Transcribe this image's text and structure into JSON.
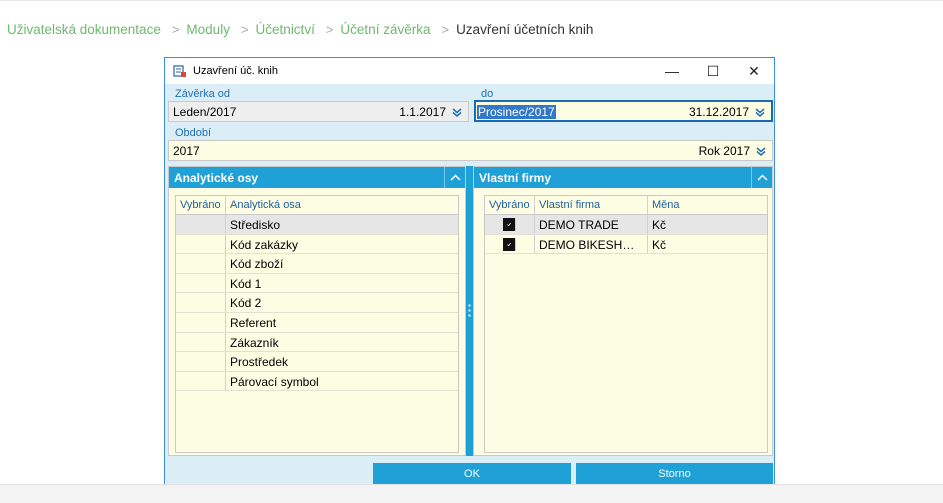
{
  "breadcrumb": {
    "items": [
      "Uživatelská dokumentace",
      "Moduly",
      "Účetnictví",
      "Účetní závěrka"
    ],
    "separator": ">",
    "current": "Uzavření účetních knih"
  },
  "dialog": {
    "title": "Uzavření úč. knih",
    "window_controls": {
      "minimize": "—",
      "maximize": "☐",
      "close": "✕"
    },
    "from": {
      "label": "Závěrka od",
      "value": "Leden/2017",
      "date": "1.1.2017"
    },
    "to": {
      "label": "do",
      "value": "Prosinec/2017",
      "date": "31.12.2017"
    },
    "period": {
      "label": "Období",
      "value": "2017",
      "detail": "Rok 2017"
    },
    "analytic_panel": {
      "title": "Analytické osy",
      "columns": [
        "Vybráno",
        "Analytická osa"
      ],
      "rows": [
        {
          "name": "Středisko"
        },
        {
          "name": "Kód zakázky"
        },
        {
          "name": "Kód zboží"
        },
        {
          "name": "Kód 1"
        },
        {
          "name": "Kód 2"
        },
        {
          "name": "Referent"
        },
        {
          "name": "Zákazník"
        },
        {
          "name": "Prostředek"
        },
        {
          "name": "Párovací symbol"
        }
      ]
    },
    "firms_panel": {
      "title": "Vlastní firmy",
      "columns": [
        "Vybráno",
        "Vlastní firma",
        "Měna"
      ],
      "rows": [
        {
          "checked": true,
          "firm": "DEMO TRADE",
          "currency": "Kč"
        },
        {
          "checked": true,
          "firm": "DEMO BIKESHOP ...",
          "currency": "Kč"
        }
      ]
    },
    "buttons": {
      "ok": "OK",
      "cancel": "Storno"
    }
  },
  "colors": {
    "accent": "#1fa1d8",
    "field_bg": "#fdfde4",
    "dialog_bg": "#dbeef8",
    "label": "#1f6fb2",
    "breadcrumb_link": "#6fb86f",
    "selected_row": "#e6e6e6"
  }
}
